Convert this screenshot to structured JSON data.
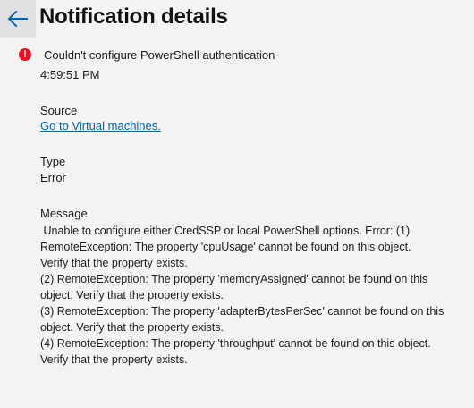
{
  "header": {
    "back_icon": "arrow-left-icon",
    "title": "Notification details"
  },
  "notification": {
    "status_icon": "error-icon",
    "status_color": "#e81123",
    "title": "Couldn't configure PowerShell authentication",
    "time": "4:59:51 PM",
    "source_label": "Source",
    "source_link": "Go to Virtual machines.",
    "type_label": "Type",
    "type_value": "Error",
    "message_label": "Message",
    "message": " Unable to configure either CredSSP or local PowerShell options. Error: (1)\nRemoteException: The property 'cpuUsage' cannot be found on this object.\nVerify that the property exists.\n(2) RemoteException: The property 'memoryAssigned' cannot be found on this\nobject. Verify that the property exists.\n(3) RemoteException: The property 'adapterBytesPerSec' cannot be found on this\nobject. Verify that the property exists.\n(4) RemoteException: The property 'throughput' cannot be found on this object.\nVerify that the property exists."
  }
}
